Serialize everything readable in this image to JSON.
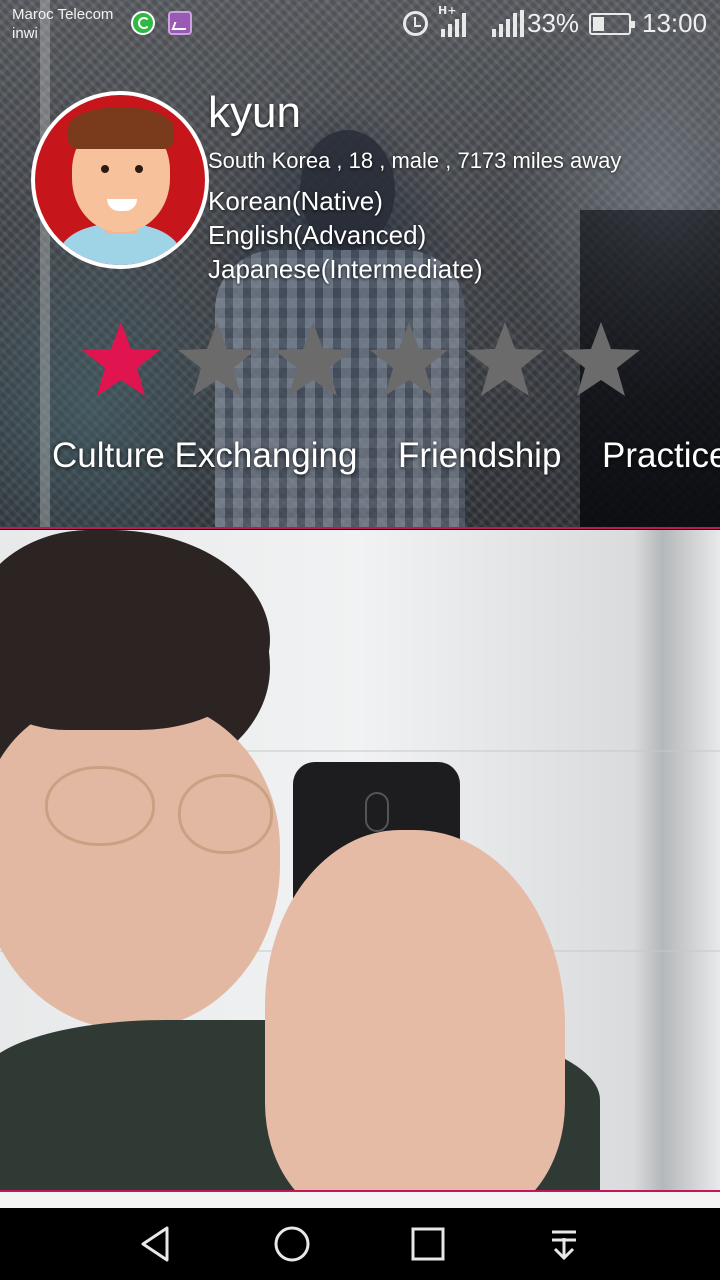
{
  "status_bar": {
    "carrier_primary": "Maroc Telecom",
    "carrier_secondary": "inwi",
    "network_type": "H+",
    "battery_percent": "33%",
    "battery_level": 0.33,
    "time": "13:00",
    "notification_icons": [
      "whatsapp-icon",
      "gallery-icon"
    ],
    "status_icons": [
      "alarm-icon",
      "signal-icon",
      "signal-icon",
      "battery-icon"
    ]
  },
  "profile": {
    "name": "kyun",
    "meta": "South Korea , 18 , male , 7173 miles away",
    "languages": [
      "Korean(Native)",
      "English(Advanced)",
      "Japanese(Intermediate)"
    ],
    "rating": 1,
    "rating_max": 6,
    "interests": [
      "Culture Exchanging",
      "Friendship",
      "Practice"
    ]
  },
  "colors": {
    "accent": "#e0144f",
    "star_active": "#e0144f",
    "star_inactive": "#6b6b6b",
    "divider": "#c2185b",
    "navbar": "#000000"
  },
  "navbar": {
    "icons": [
      "back-icon",
      "home-icon",
      "recents-icon",
      "notification-pull-icon"
    ]
  }
}
